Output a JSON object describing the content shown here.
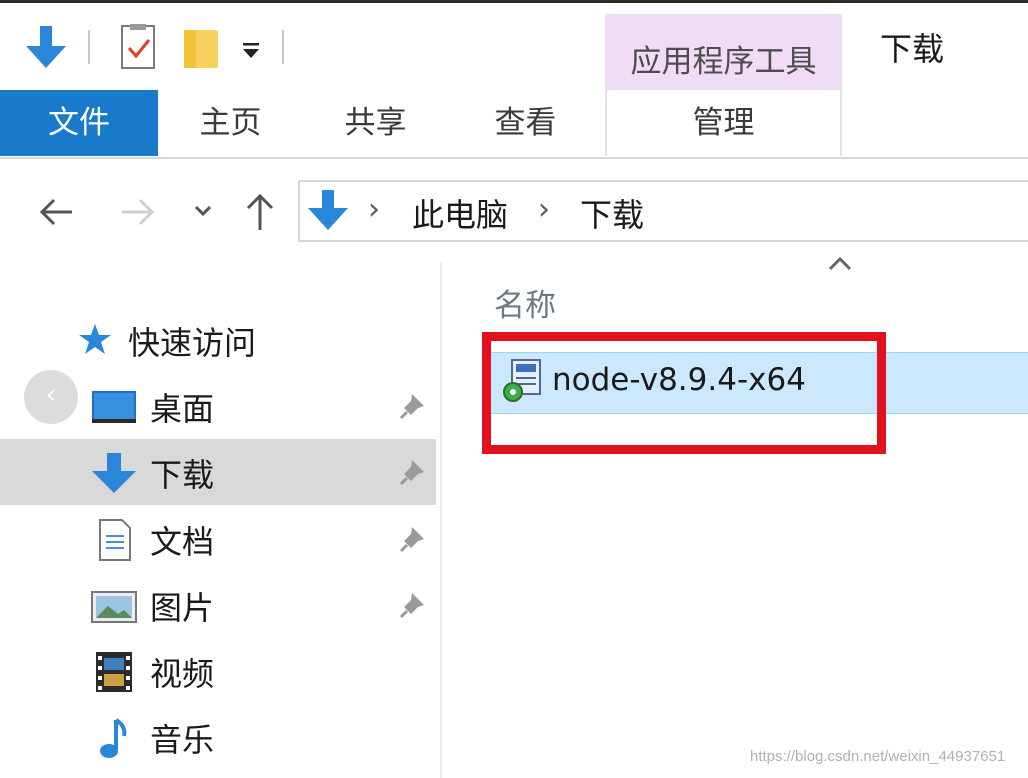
{
  "quick_access_toolbar": {
    "icons": [
      "download-arrow-icon",
      "properties-icon",
      "new-folder-icon",
      "customize-dropdown-icon"
    ]
  },
  "ribbon": {
    "contextual_header": "应用程序工具",
    "window_title": "下载",
    "tabs": [
      {
        "label": "文件",
        "active": true
      },
      {
        "label": "主页"
      },
      {
        "label": "共享"
      },
      {
        "label": "查看"
      },
      {
        "label": "管理"
      }
    ]
  },
  "address_bar": {
    "breadcrumbs": [
      "此电脑",
      "下载"
    ],
    "separator": "›"
  },
  "nav_pane": {
    "quick_access_label": "快速访问",
    "collapse_glyph": "‹",
    "items": [
      {
        "label": "桌面",
        "icon": "desktop-icon",
        "pinned": true
      },
      {
        "label": "下载",
        "icon": "download-icon",
        "pinned": true,
        "selected": true
      },
      {
        "label": "文档",
        "icon": "document-icon",
        "pinned": true
      },
      {
        "label": "图片",
        "icon": "pictures-icon",
        "pinned": true
      },
      {
        "label": "视频",
        "icon": "video-icon",
        "pinned": false
      },
      {
        "label": "音乐",
        "icon": "music-icon",
        "pinned": false
      }
    ]
  },
  "file_list": {
    "column_name": "名称",
    "files": [
      {
        "name": "node-v8.9.4-x64",
        "selected": true
      }
    ]
  },
  "watermark": "https://blog.csdn.net/weixin_44937651",
  "colors": {
    "accent": "#1979ca",
    "selection": "#cce8ff",
    "contextual": "#f1dcf5",
    "highlight_box": "#e3101d"
  }
}
